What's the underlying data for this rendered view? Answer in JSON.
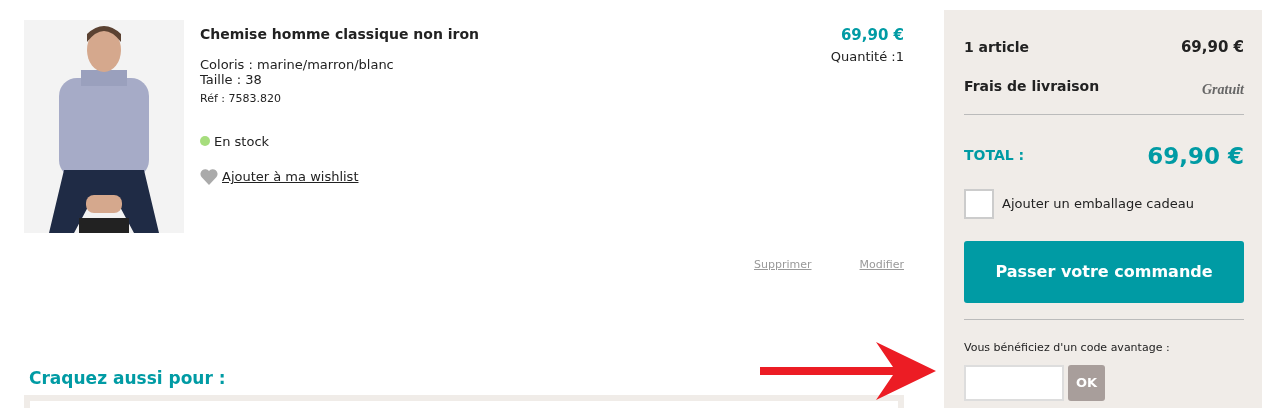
{
  "product": {
    "name": "Chemise homme classique non iron",
    "attributes": [
      "Coloris : marine/marron/blanc",
      "Taille : 38"
    ],
    "reference": "Réf : 7583.820",
    "stock": {
      "label": "En stock",
      "color": "#a6dd7d"
    },
    "wishlist": "Ajouter à ma wishlist",
    "price": "69,90 €",
    "quantity": "Quantité :1",
    "actions": [
      "Supprimer",
      "Modifier"
    ]
  },
  "suggestions": {
    "title": "Craquez aussi pour :"
  },
  "summary": {
    "lines": [
      {
        "label": "1 article",
        "value": "69,90 €",
        "kind": "amount"
      },
      {
        "label": "Frais de livraison",
        "value": "Gratuit",
        "kind": "note"
      }
    ],
    "total_label": "TOTAL :",
    "total": "69,90 €",
    "gift_wrap": {
      "label": "Ajouter un emballage cadeau",
      "checked": false
    },
    "order_button": "Passer votre commande",
    "promo": {
      "label": "Vous bénéficiez d'un code avantage :",
      "button": "OK"
    }
  },
  "annotation": {
    "kind": "arrow"
  }
}
